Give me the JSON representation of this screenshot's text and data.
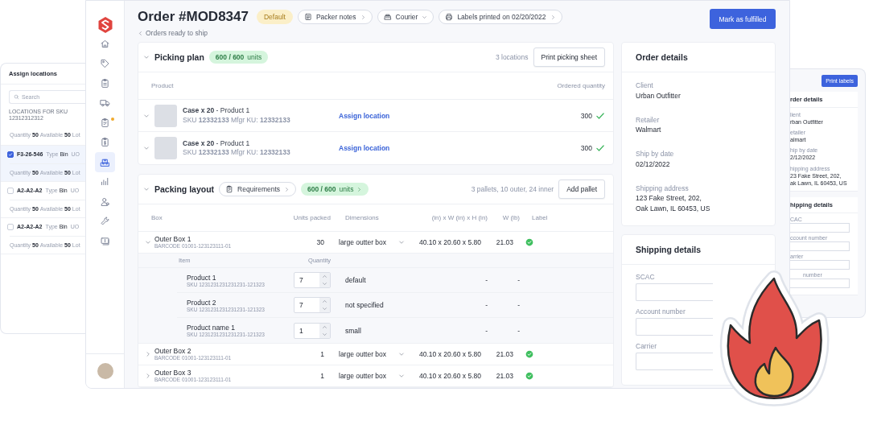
{
  "assign_locations": {
    "title": "Assign locations",
    "search": {
      "placeholder": "Search"
    },
    "section_label": "LOCATIONS FOR SKU 12312312312",
    "locations": [
      {
        "kind": "partial",
        "quantity_label": "Quantity",
        "quantity": "50",
        "available_label": "Available",
        "available": "50",
        "lot_label": "Lot",
        "selected": false
      },
      {
        "kind": "full",
        "code": "F3-26-546",
        "type_label": "Type",
        "type": "Bin",
        "uom": "UO",
        "quantity_label": "Quantity",
        "quantity": "50",
        "available_label": "Available",
        "available": "50",
        "lot_label": "Lot",
        "selected": true
      },
      {
        "kind": "full",
        "code": "A2-A2-A2",
        "type_label": "Type",
        "type": "Bin",
        "uom": "UO",
        "quantity_label": "Quantity",
        "quantity": "50",
        "available_label": "Available",
        "available": "50",
        "lot_label": "Lot",
        "selected": false
      },
      {
        "kind": "full",
        "code": "A2-A2-A2",
        "type_label": "Type",
        "type": "Bin",
        "uom": "UO",
        "quantity_label": "Quantity",
        "quantity": "50",
        "available_label": "Available",
        "available": "50",
        "lot_label": "Lot",
        "selected": false
      }
    ]
  },
  "sidebar": {
    "items": [
      {
        "kind": "home",
        "selected": false,
        "notification": false
      },
      {
        "kind": "tag",
        "selected": false,
        "notification": false
      },
      {
        "kind": "clipboard",
        "selected": false,
        "notification": false
      },
      {
        "kind": "truck",
        "selected": false,
        "notification": false
      },
      {
        "kind": "checklist",
        "selected": false,
        "notification": true
      },
      {
        "kind": "invoice",
        "selected": false,
        "notification": false
      },
      {
        "kind": "warehouse",
        "selected": true,
        "notification": false
      },
      {
        "kind": "chart",
        "selected": false,
        "notification": false
      },
      {
        "kind": "users",
        "selected": false,
        "notification": false
      },
      {
        "kind": "wrench",
        "selected": false,
        "notification": false
      },
      {
        "kind": "billing",
        "selected": false,
        "notification": false
      }
    ]
  },
  "header": {
    "title": "Order #MOD8347",
    "status_badge": "Default",
    "chips": [
      {
        "kind": "notes",
        "label": "Packer notes"
      },
      {
        "kind": "courier",
        "label": "Courier"
      },
      {
        "kind": "printer",
        "label": "Labels printed on 02/20/2022"
      }
    ],
    "back_link": "Orders ready to ship",
    "primary_button": "Mark as fulfilled"
  },
  "picking_plan": {
    "title": "Picking plan",
    "progress": "**600 / 600** units",
    "locations_count": "3 locations",
    "print_button": "Print picking sheet",
    "columns": [
      "Product",
      "Ordered quantity"
    ],
    "rows": [
      {
        "name": "**Case x 20** - Product 1",
        "sku": "SKU **12332133** Mfgr KU: **12332133**",
        "action": "Assign location",
        "quantity": "300",
        "complete": true
      },
      {
        "name": "**Case x 20** - Product 1",
        "sku": "SKU **12332133** Mfgr KU: **12332133**",
        "action": "Assign location",
        "quantity": "300",
        "complete": true
      }
    ]
  },
  "packing_layout": {
    "title": "Packing layout",
    "requirements_chip": "Requirements",
    "progress": "**600 / 600** units",
    "summary": "3 pallets, 10 outer, 24 inner",
    "add_button": "Add pallet",
    "columns": [
      "Box",
      "Units packed",
      "Dimensions",
      "(in) x W (in) x H (in)",
      "W (lb)",
      "Label"
    ],
    "boxes": [
      {
        "name": "Outer Box 1",
        "barcode": "BARCODE 01001-123123111-01",
        "units": "30",
        "dimension": "large outter box",
        "size": "40.10 x 20.60 x 5.80",
        "weight": "21.03",
        "label_ok": true,
        "expanded": true,
        "item_columns": [
          "Item",
          "Quantity"
        ],
        "items": [
          {
            "name": "Product 1",
            "sku": "SKU 1231231231231231-121323",
            "quantity": "7",
            "dimension": "default",
            "size": "-",
            "weight": "-"
          },
          {
            "name": "Product 2",
            "sku": "SKU 1231231231231231-121323",
            "quantity": "7",
            "dimension": "not specified",
            "size": "-",
            "weight": "-"
          },
          {
            "name": "Product name 1",
            "sku": "SKU 1231231231231231-121323",
            "quantity": "1",
            "dimension": "small",
            "size": "-",
            "weight": "-"
          }
        ]
      },
      {
        "name": "Outer Box 2",
        "barcode": "BARCODE 01001-123123111-01",
        "units": "1",
        "dimension": "large outter box",
        "size": "40.10 x 20.60 x 5.80",
        "weight": "21.03",
        "label_ok": true,
        "expanded": false
      },
      {
        "name": "Outer Box 3",
        "barcode": "BARCODE 01001-123123111-01",
        "units": "1",
        "dimension": "large outter box",
        "size": "40.10 x 20.60 x 5.80",
        "weight": "21.03",
        "label_ok": true,
        "expanded": false
      }
    ]
  },
  "order_details": {
    "title": "Order details",
    "fields": [
      {
        "label": "Client",
        "lines": [
          "Urban Outfitter"
        ]
      },
      {
        "label": "Retailer",
        "lines": [
          "Walmart"
        ]
      },
      {
        "label": "Ship by date",
        "lines": [
          "02/12/2022"
        ]
      },
      {
        "label": "Shipping address",
        "lines": [
          "123 Fake Street, 202,",
          "Oak Lawn, IL 60453, US"
        ]
      }
    ]
  },
  "shipping_details": {
    "title": "Shipping details",
    "fields": [
      {
        "label": "SCAC"
      },
      {
        "label": "Account number"
      },
      {
        "label": "Carrier"
      }
    ]
  },
  "back_panel": {
    "print_button": "Print labels",
    "order_title": "rder details",
    "fields": [
      {
        "label": "lient",
        "lines": [
          "rban Outfitter"
        ]
      },
      {
        "label": "etailer",
        "lines": [
          "almart"
        ]
      },
      {
        "label": "hip by date",
        "lines": [
          "2/12/2022"
        ]
      },
      {
        "label": "hipping address",
        "lines": [
          "23 Fake Street, 202,",
          "ak Lawn, IL 60453, US"
        ]
      }
    ],
    "shipping_title": "hipping details",
    "shipping_fields": [
      {
        "label": "CAC"
      },
      {
        "label": "ccount number"
      },
      {
        "label": "arrier"
      },
      {
        "label": "number"
      }
    ]
  }
}
